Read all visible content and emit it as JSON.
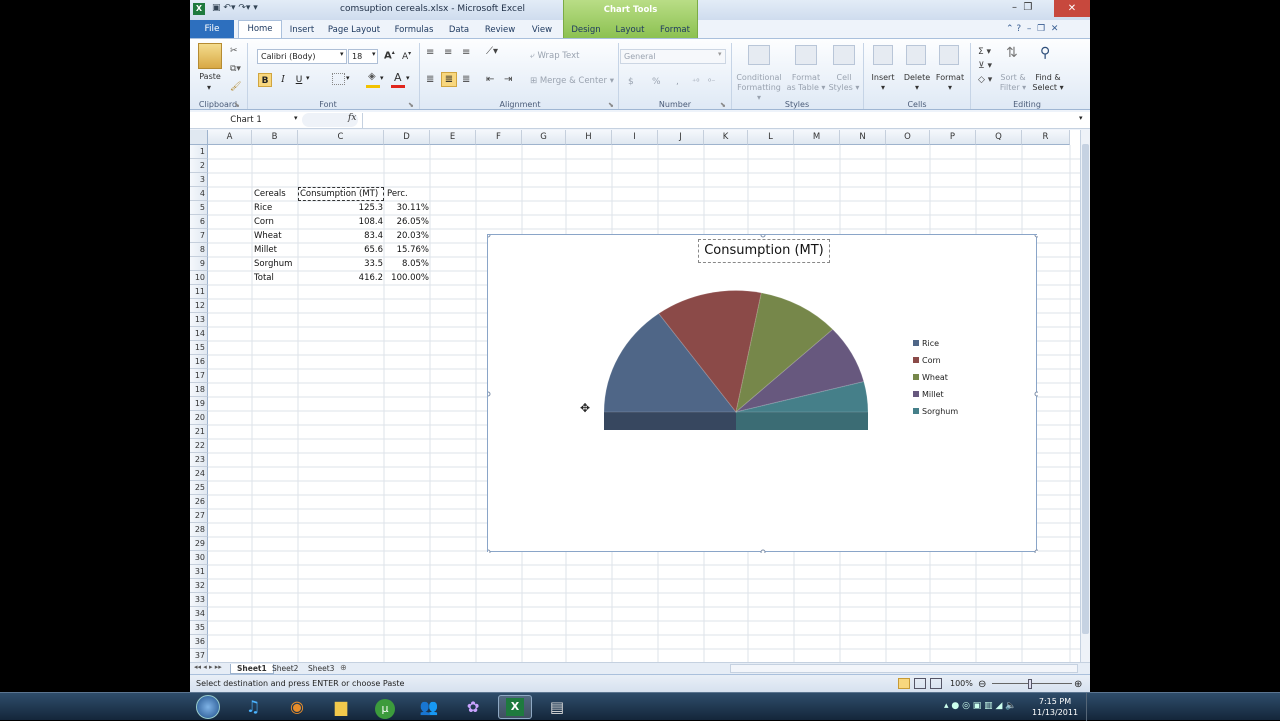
{
  "window": {
    "title": "comsuption cereals.xlsx - Microsoft Excel",
    "context_tab": "Chart Tools"
  },
  "tabs": [
    "File",
    "Home",
    "Insert",
    "Page Layout",
    "Formulas",
    "Data",
    "Review",
    "View",
    "Design",
    "Layout",
    "Format"
  ],
  "ribbon": {
    "clipboard": {
      "paste": "Paste",
      "label": "Clipboard"
    },
    "font": {
      "family": "Calibri (Body)",
      "size": "18",
      "label": "Font",
      "bold": "B",
      "italic": "I",
      "underline": "U"
    },
    "alignment": {
      "wrap": "Wrap Text",
      "merge": "Merge & Center",
      "label": "Alignment"
    },
    "number": {
      "format": "General",
      "currency": "$",
      "percent": "%",
      "comma": ",",
      "label": "Number"
    },
    "styles": {
      "conditional": "Conditional",
      "conditional2": "Formatting",
      "table": "Format",
      "table2": "as Table",
      "cell": "Cell",
      "cell2": "Styles",
      "label": "Styles"
    },
    "cells": {
      "insert": "Insert",
      "delete": "Delete",
      "format": "Format",
      "label": "Cells"
    },
    "editing": {
      "sort": "Sort &",
      "sort2": "Filter",
      "find": "Find &",
      "find2": "Select",
      "label": "Editing"
    }
  },
  "formula_bar": {
    "name_box": "Chart 1",
    "fx": "fx",
    "value": ""
  },
  "columns": [
    "A",
    "B",
    "C",
    "D",
    "E",
    "F",
    "G",
    "H",
    "I",
    "J",
    "K",
    "L",
    "M",
    "N",
    "O",
    "P",
    "Q",
    "R"
  ],
  "rows": [
    "1",
    "2",
    "3",
    "4",
    "5",
    "6",
    "7",
    "8",
    "9",
    "10",
    "11",
    "12",
    "13",
    "14",
    "15",
    "16",
    "17",
    "18",
    "19",
    "20",
    "21",
    "22",
    "23",
    "24",
    "25",
    "26",
    "27",
    "28",
    "29",
    "30",
    "31",
    "32",
    "33",
    "34",
    "35",
    "36",
    "37"
  ],
  "table": {
    "headers": [
      "Cereals",
      "Consumption (MT)",
      "Perc."
    ],
    "rows": [
      [
        "Rice",
        "125.3",
        "30.11%"
      ],
      [
        "Corn",
        "108.4",
        "26.05%"
      ],
      [
        "Wheat",
        "83.4",
        "20.03%"
      ],
      [
        "Millet",
        "65.6",
        "15.76%"
      ],
      [
        "Sorghum",
        "33.5",
        "8.05%"
      ],
      [
        "Total",
        "416.2",
        "100.00%"
      ]
    ]
  },
  "chart_data": {
    "type": "pie",
    "title": "Consumption (MT)",
    "categories": [
      "Rice",
      "Corn",
      "Wheat",
      "Millet",
      "Sorghum"
    ],
    "values": [
      125.3,
      108.4,
      83.4,
      65.6,
      33.5
    ],
    "colors": [
      "#4f6687",
      "#8b4a48",
      "#76874a",
      "#67587e",
      "#457f89"
    ],
    "legend_position": "right"
  },
  "sheets": [
    "Sheet1",
    "Sheet2",
    "Sheet3"
  ],
  "status": {
    "message": "Select destination and press ENTER or choose Paste",
    "zoom": "100%"
  },
  "clock": {
    "time": "7:15 PM",
    "date": "11/13/2011"
  }
}
